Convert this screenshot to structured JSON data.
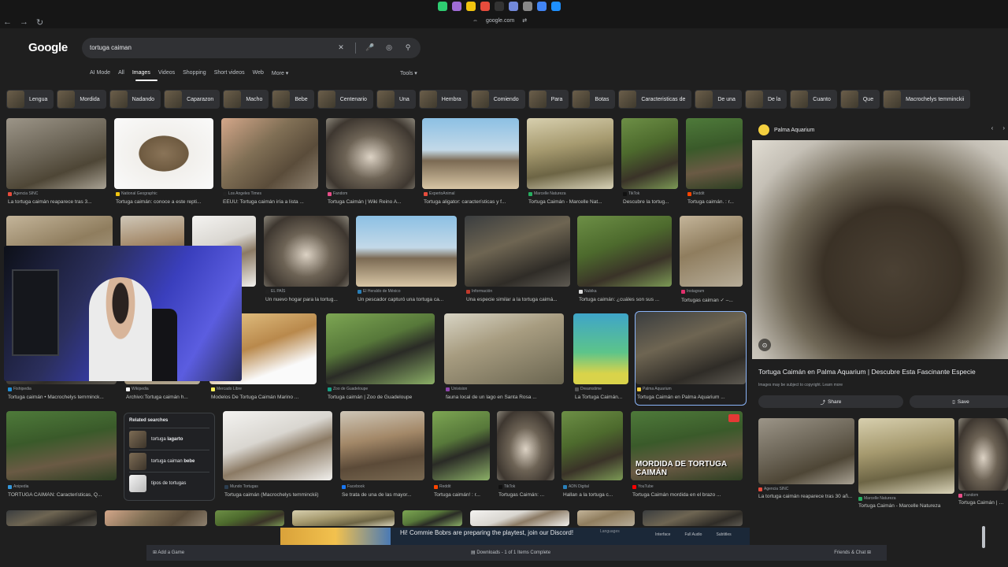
{
  "browser": {
    "url": "google.com",
    "nav": {
      "back": "←",
      "forward": "→",
      "reload": "↻"
    }
  },
  "search": {
    "logo": "Google",
    "query": "tortuga caiman"
  },
  "tabs": [
    "AI Mode",
    "All",
    "Images",
    "Videos",
    "Shopping",
    "Short videos",
    "Web",
    "More ▾"
  ],
  "tools": "Tools ▾",
  "chips": [
    "Lengua",
    "Mordida",
    "Nadando",
    "Caparazon",
    "Macho",
    "Bebe",
    "Centenario",
    "Una",
    "Hembra",
    "Comiendo",
    "Para",
    "Botas",
    "Caracteristicas de",
    "De una",
    "De la",
    "Cuanto",
    "Que",
    "Macrochelys temminckii"
  ],
  "row1": [
    {
      "src": "Agencia SINC",
      "title": "La tortuga caimán reaparece tras 3..."
    },
    {
      "src": "National Geographic",
      "title": "Tortuga caimán: conoce a este repti..."
    },
    {
      "src": "Los Angeles Times",
      "title": "EEUU: Tortuga caimán iría a lista ..."
    },
    {
      "src": "Fandom",
      "title": "Tortuga Caimán | Wiki Reino A..."
    },
    {
      "src": "ExpertoAnimal",
      "title": "Tortuga aligator: características y f..."
    },
    {
      "src": "Marcelle Natureza",
      "title": "Tortuga Caimán - Marcelle Nat..."
    },
    {
      "src": "TikTok",
      "title": "Descubre la tortug..."
    },
    {
      "src": "Reddit",
      "title": "Tortuga caimán. : r..."
    }
  ],
  "row2": [
    {
      "src": "EL PAÍS",
      "title": "Un nuevo hogar para la tortug..."
    },
    {
      "src": "El Heraldo de México",
      "title": "Un pescador capturó una tortuga ca..."
    },
    {
      "src": "Información",
      "title": "Una especie similar a la tortuga caimá..."
    },
    {
      "src": "Nubika",
      "title": "Tortuga caimán: ¿cuáles son sus ..."
    },
    {
      "src": "Instagram",
      "title": "Tortugas caiman ✓ –..."
    }
  ],
  "row3": [
    {
      "src": "Fishipedia",
      "title": "Tortuga caimán • Macrochelys temminck..."
    },
    {
      "src": "Wikipedia",
      "title": "Archivo:Tortuga caimán h..."
    },
    {
      "src": "Mercado Libre",
      "title": "Modelos De Tortuga Caimán Marino ..."
    },
    {
      "src": "Zoo de Guadeloupe",
      "title": "Tortuga caimán | Zoo de Guadeloupe"
    },
    {
      "src": "Univision",
      "title": "fauna local de un lago en Santa Rosa ..."
    },
    {
      "src": "Dreamstime",
      "title": "La Tortuga Caimán..."
    },
    {
      "src": "Palma Aquarium",
      "title": "Tortuga Caimán en Palma Aquarium ..."
    }
  ],
  "row4": [
    {
      "src": "Anipedia",
      "title": "TORTUGA CAIMÁN: Características, Q..."
    },
    {
      "src": "Mundo Tortugas",
      "title": "Tortuga caimán (Macrochelys temminckii)"
    },
    {
      "src": "Facebook",
      "title": "Se trata de una de las mayor..."
    },
    {
      "src": "Reddit",
      "title": "Tortuga caimán! : r..."
    },
    {
      "src": "TikTok",
      "title": "Tortugas Caimán: ..."
    },
    {
      "src": "ADN Digital",
      "title": "Hallan a la tortuga c..."
    },
    {
      "src": "YouTube",
      "title": "Tortuga Caimán mordida en el brazo ..."
    }
  ],
  "overlay_text": "MORDIDA DE TORTUGA CAIMÁN",
  "related": {
    "header": "Related searches",
    "items": [
      {
        "prefix": "tortuga ",
        "bold": "lagarto"
      },
      {
        "prefix": "tortuga caiman ",
        "bold": "bebe"
      },
      {
        "prefix": "tipos de tortugas",
        "bold": ""
      }
    ]
  },
  "panel": {
    "source": "Palma Aquarium",
    "title": "Tortuga Caimán en Palma Aquarium | Descubre Esta Fascinante Especie",
    "note": "Images may be subject to copyright. Learn more",
    "share": "Share",
    "save": "Save",
    "related": [
      {
        "src": "Agencia SINC",
        "title": "La tortuga caimán reaparece tras 30 añ..."
      },
      {
        "src": "Marcelle Natureza",
        "title": "Tortuga Caimán - Marcelle Natureza"
      },
      {
        "src": "Fandom",
        "title": "Tortuga Caimán | Wiki"
      }
    ]
  },
  "popup": {
    "text": "Hi! Commie Bobrs are preparing the playtest, join our Discord!",
    "lang_label": "Languages",
    "cols": [
      "Interface",
      "Full Audio",
      "Subtitles"
    ]
  },
  "taskbar": {
    "add_game": "Add a Game",
    "downloads": "Downloads - 1 of 1 Items Complete",
    "friends": "Friends & Chat"
  }
}
